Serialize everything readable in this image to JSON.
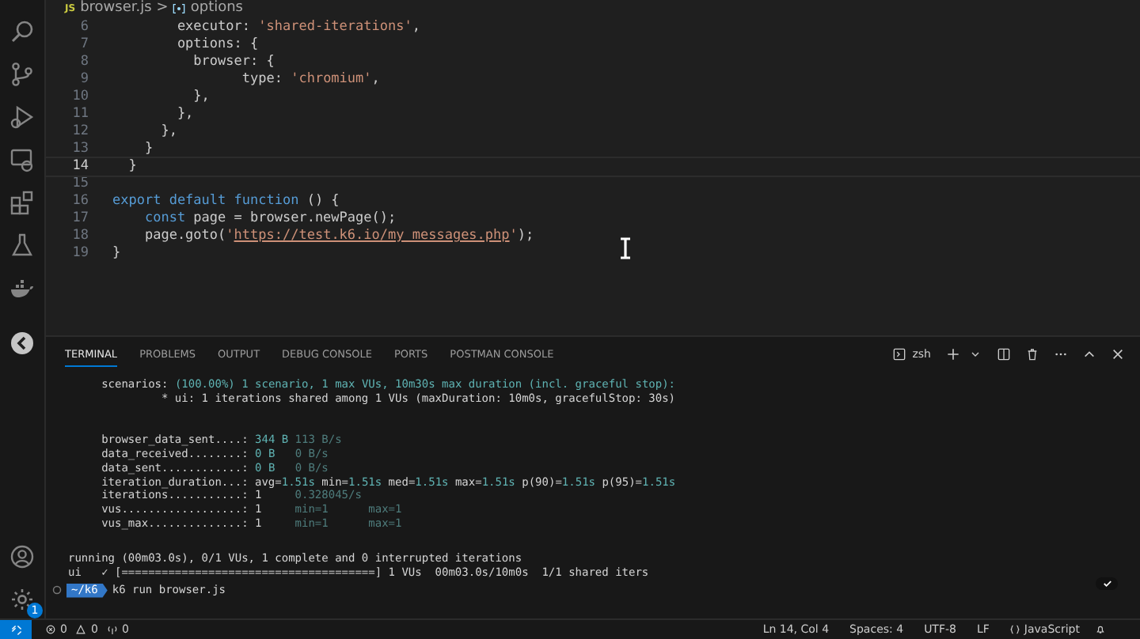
{
  "breadcrumb": {
    "file_badge": "JS",
    "file": "browser.js",
    "separator": ">",
    "symbol": "options"
  },
  "activity_bar": {
    "settings_badge": "1"
  },
  "editor": {
    "lines": [
      {
        "n": "6",
        "current": false,
        "tokens": [
          {
            "kind": "plain",
            "t": "        executor: "
          },
          {
            "kind": "string",
            "t": "'shared-iterations'"
          },
          {
            "kind": "plain",
            "t": ","
          }
        ]
      },
      {
        "n": "7",
        "current": false,
        "tokens": [
          {
            "kind": "plain",
            "t": "        options: {"
          }
        ]
      },
      {
        "n": "8",
        "current": false,
        "tokens": [
          {
            "kind": "plain",
            "t": "          browser: {"
          }
        ]
      },
      {
        "n": "9",
        "current": false,
        "tokens": [
          {
            "kind": "plain",
            "t": "                type: "
          },
          {
            "kind": "string",
            "t": "'chromium'"
          },
          {
            "kind": "plain",
            "t": ","
          }
        ]
      },
      {
        "n": "10",
        "current": false,
        "tokens": [
          {
            "kind": "plain",
            "t": "          },"
          }
        ]
      },
      {
        "n": "11",
        "current": false,
        "tokens": [
          {
            "kind": "plain",
            "t": "        },"
          }
        ]
      },
      {
        "n": "12",
        "current": false,
        "tokens": [
          {
            "kind": "plain",
            "t": "      },"
          }
        ]
      },
      {
        "n": "13",
        "current": false,
        "tokens": [
          {
            "kind": "plain",
            "t": "    }"
          }
        ]
      },
      {
        "n": "14",
        "current": true,
        "tokens": [
          {
            "kind": "plain",
            "t": "  }"
          }
        ]
      },
      {
        "n": "15",
        "current": false
      },
      {
        "n": "16",
        "current": false,
        "tokens": [
          {
            "kind": "keyword",
            "t": "export default function"
          },
          {
            "kind": "plain",
            "t": " () {"
          }
        ]
      },
      {
        "n": "17",
        "current": false,
        "tokens": [
          {
            "kind": "keyword",
            "t": "    const"
          },
          {
            "kind": "plain",
            "t": " page = browser.newPage();"
          }
        ]
      },
      {
        "n": "18",
        "current": false,
        "tokens": [
          {
            "kind": "plain",
            "t": "    page.goto("
          },
          {
            "kind": "string",
            "t": "'"
          },
          {
            "kind": "url",
            "t": "https://test.k6.io/my_messages.php"
          },
          {
            "kind": "string",
            "t": "'"
          },
          {
            "kind": "plain",
            "t": ");"
          }
        ]
      },
      {
        "n": "19",
        "current": false,
        "tokens": [
          {
            "kind": "plain",
            "t": "}"
          }
        ]
      }
    ]
  },
  "panel": {
    "tabs": [
      {
        "label": "TERMINAL",
        "selected": true
      },
      {
        "label": "PROBLEMS",
        "selected": false
      },
      {
        "label": "OUTPUT",
        "selected": false
      },
      {
        "label": "DEBUG CONSOLE",
        "selected": false
      },
      {
        "label": "PORTS",
        "selected": false
      },
      {
        "label": "POSTMAN CONSOLE",
        "selected": false
      }
    ],
    "shell": "zsh"
  },
  "terminal": {
    "blocks": [
      [
        [
          {
            "kind": "normal",
            "t": "     scenarios: "
          },
          {
            "kind": "value",
            "t": "(100.00%) 1 scenario, 1 max VUs, 10m30s max duration (incl. graceful stop):"
          }
        ],
        [
          {
            "kind": "normal",
            "t": "              * ui: 1 iterations shared among 1 VUs (maxDuration: 10m0s, gracefulStop: 30s)"
          }
        ]
      ],
      [
        [
          {
            "kind": "normal",
            "t": "     browser_data_sent....: "
          },
          {
            "kind": "value",
            "t": "344 B"
          },
          {
            "kind": "dim",
            "t": " 113 B/s"
          }
        ],
        [
          {
            "kind": "normal",
            "t": "     data_received........: "
          },
          {
            "kind": "value",
            "t": "0 B"
          },
          {
            "kind": "dim",
            "t": "   0 B/s"
          }
        ],
        [
          {
            "kind": "normal",
            "t": "     data_sent............: "
          },
          {
            "kind": "value",
            "t": "0 B"
          },
          {
            "kind": "dim",
            "t": "   0 B/s"
          }
        ],
        [
          {
            "kind": "normal",
            "t": "     iteration_duration...: avg="
          },
          {
            "kind": "value",
            "t": "1.51s"
          },
          {
            "kind": "normal",
            "t": " min="
          },
          {
            "kind": "value",
            "t": "1.51s"
          },
          {
            "kind": "normal",
            "t": " med="
          },
          {
            "kind": "value",
            "t": "1.51s"
          },
          {
            "kind": "normal",
            "t": " max="
          },
          {
            "kind": "value",
            "t": "1.51s"
          },
          {
            "kind": "normal",
            "t": " p(90)="
          },
          {
            "kind": "value",
            "t": "1.51s"
          },
          {
            "kind": "normal",
            "t": " p(95)="
          },
          {
            "kind": "value",
            "t": "1.51s"
          }
        ],
        [
          {
            "kind": "normal",
            "t": "     iterations...........: 1"
          },
          {
            "kind": "dim",
            "t": "     0.328045/s"
          }
        ],
        [
          {
            "kind": "normal",
            "t": "     vus..................: 1"
          },
          {
            "kind": "dim",
            "t": "     min=1      max=1"
          }
        ],
        [
          {
            "kind": "normal",
            "t": "     vus_max..............: 1"
          },
          {
            "kind": "dim",
            "t": "     min=1      max=1"
          }
        ]
      ],
      [
        [
          {
            "kind": "normal",
            "t": "running (00m03.0s), 0/1 VUs, 1 complete and 0 interrupted iterations"
          }
        ],
        [
          {
            "kind": "normal",
            "t": "ui   ✓ [======================================] 1 VUs  00m03.0s/10m0s  1/1 shared iters"
          }
        ]
      ]
    ],
    "prompt": {
      "dir": "~/k6",
      "command": "k6 run browser.js"
    }
  },
  "status_bar": {
    "errors": "0",
    "warnings": "0",
    "ports": "0",
    "right": [
      "Ln 14, Col 4",
      "Spaces: 4",
      "UTF-8",
      "LF"
    ],
    "language": "JavaScript"
  }
}
